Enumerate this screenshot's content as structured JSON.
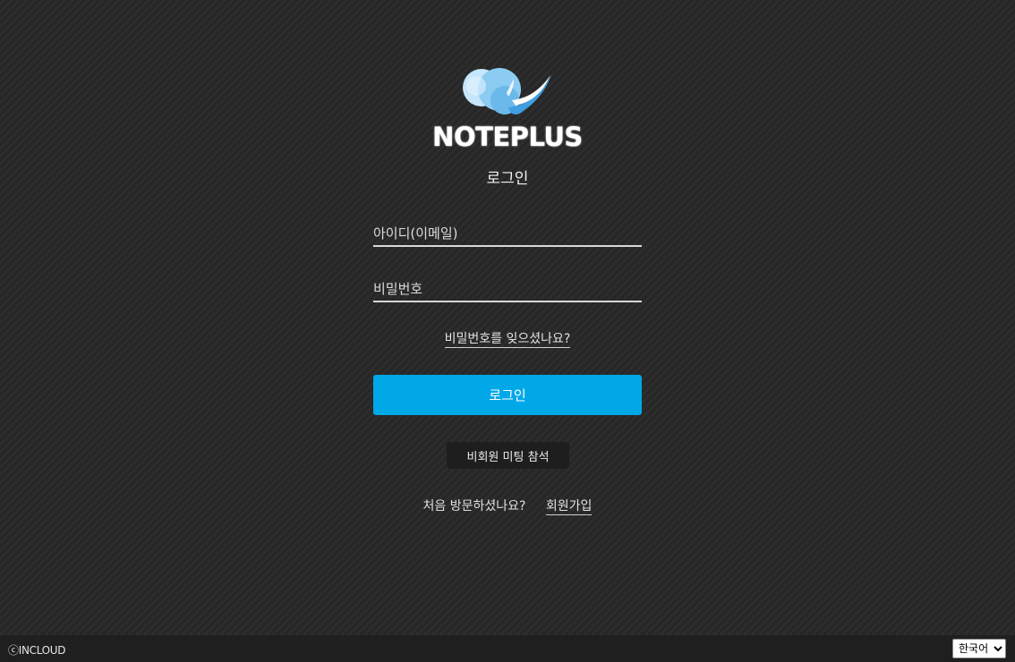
{
  "brand": {
    "logo_icon": "noteplus-cloud-logo-icon",
    "name": "NOTEPLUS"
  },
  "login": {
    "title": "로그인",
    "id_placeholder": "아이디(이메일)",
    "id_value": "",
    "password_placeholder": "비밀번호",
    "password_value": "",
    "forgot_password": "비밀번호를 잊으셨나요?",
    "submit_label": "로그인",
    "guest_meeting_label": "비회원 미팅 참석",
    "signup_prompt": "처음 방문하셨나요?",
    "signup_link": "회원가입"
  },
  "footer": {
    "copyright": "ⓒINCLOUD",
    "language_selected": "한국어"
  },
  "colors": {
    "accent": "#00a8e8",
    "background": "#2a2a2a",
    "footer": "#1f1f1f"
  }
}
